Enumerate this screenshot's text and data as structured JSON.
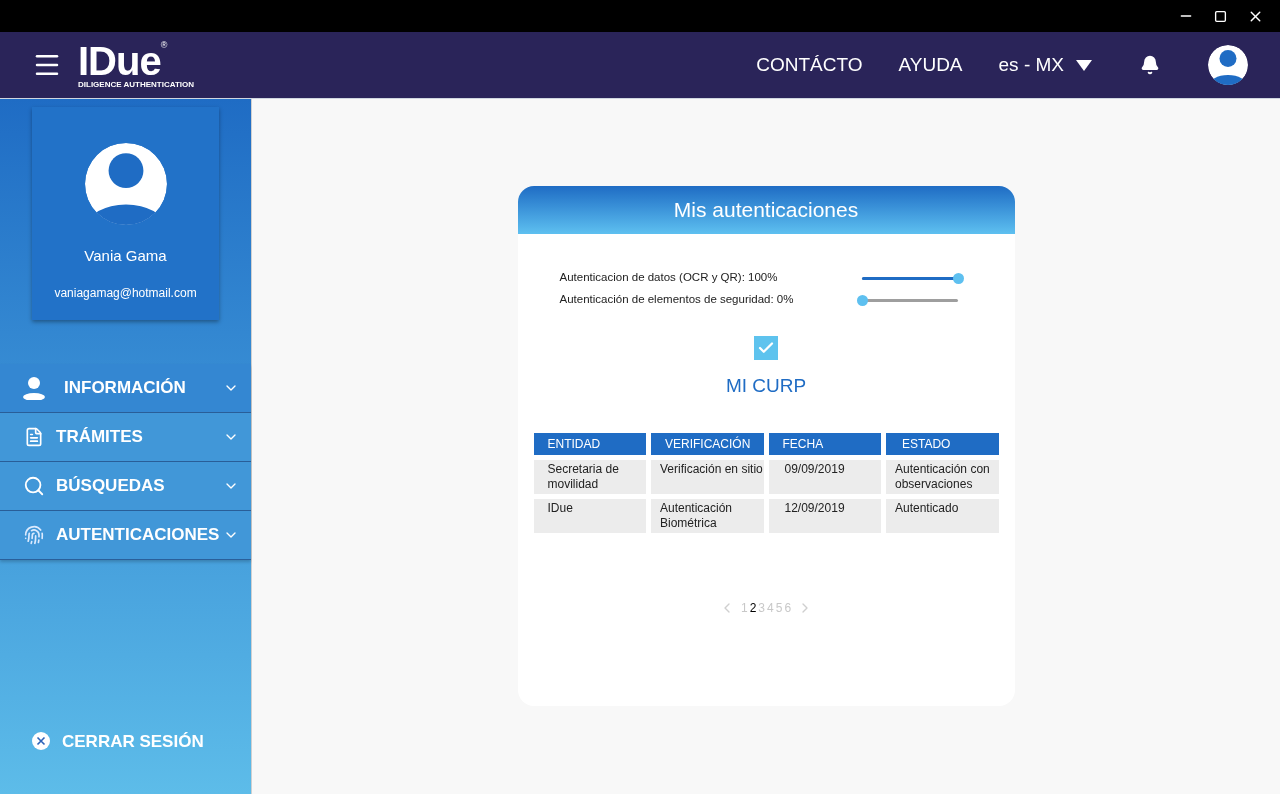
{
  "header": {
    "logo": {
      "name": "IDue",
      "mark": "®",
      "tagline": "DILIGENCE AUTHENTICATION"
    },
    "links": [
      "CONTÁCTO",
      "AYUDA"
    ],
    "language": "es - MX"
  },
  "profile": {
    "name": "Vania Gama",
    "email": "vaniagamag@hotmail.com"
  },
  "sidebar": {
    "items": [
      {
        "label": "INFORMACIÓN",
        "expanded": false
      },
      {
        "label": "TRÁMITES",
        "expanded": false
      },
      {
        "label": "BÚSQUEDAS",
        "expanded": false
      },
      {
        "label": "AUTENTICACIONES",
        "expanded": false
      }
    ],
    "logout": "CERRAR SESIÓN"
  },
  "card": {
    "title": "Mis autenticaciones",
    "progress": [
      {
        "label": "Autenticacion de datos (OCR y QR): 100%",
        "level": 1
      },
      {
        "label": "Autenticación de elementos de seguridad: 0%",
        "level": 0
      }
    ],
    "document": {
      "checked": true,
      "label": "MI CURP"
    },
    "table": {
      "columns": [
        "ENTIDAD",
        "VERIFICACIÓN",
        "FECHA",
        "ESTADO"
      ],
      "rows": [
        [
          "Secretaria de movilidad",
          "Verificación en sitio",
          "09/09/2019",
          "Autenticación con observaciones"
        ],
        [
          "IDue",
          "Autenticación Biométrica",
          "12/09/2019",
          "Autenticado"
        ]
      ]
    },
    "pagination": {
      "pages": [
        {
          "label": "1",
          "selected": false
        },
        {
          "label": "2",
          "selected": true
        },
        {
          "label": "3",
          "selected": false
        },
        {
          "label": "4",
          "selected": false
        },
        {
          "label": "5",
          "selected": false
        },
        {
          "label": "6",
          "selected": false
        }
      ]
    }
  }
}
